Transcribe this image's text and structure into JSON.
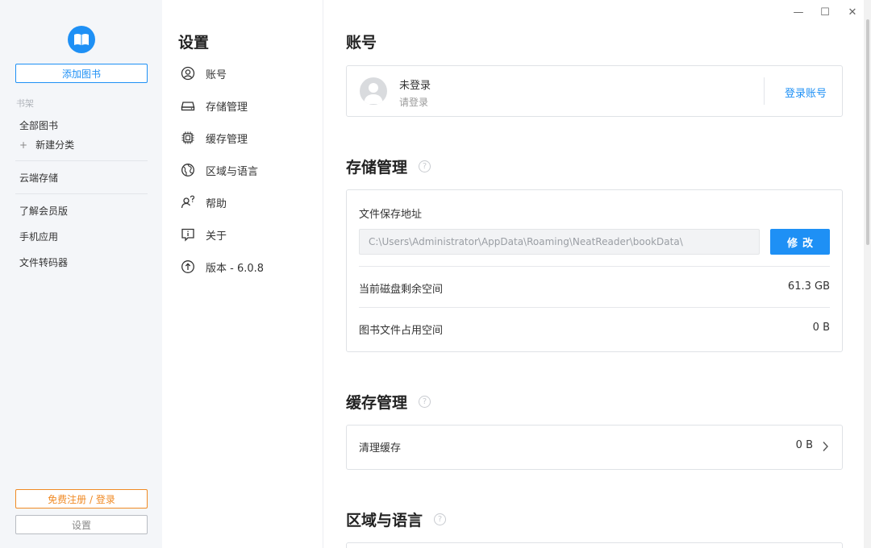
{
  "sidebar": {
    "add_book": "添加图书",
    "shelf_title": "书架",
    "all_books": "全部图书",
    "new_category_plus": "+",
    "new_category": "新建分类",
    "cloud_storage": "云端存储",
    "membership": "了解会员版",
    "mobile_app": "手机应用",
    "file_converter": "文件转码器",
    "register_login": "免费注册 / 登录",
    "settings": "设置"
  },
  "settings_nav": {
    "title": "设置",
    "items": [
      {
        "label": "账号",
        "icon": "account-icon"
      },
      {
        "label": "存储管理",
        "icon": "storage-icon"
      },
      {
        "label": "缓存管理",
        "icon": "chip-icon"
      },
      {
        "label": "区域与语言",
        "icon": "globe-icon"
      },
      {
        "label": "帮助",
        "icon": "help-user-icon"
      },
      {
        "label": "关于",
        "icon": "info-icon"
      },
      {
        "label": "版本 - 6.0.8",
        "icon": "upgrade-icon"
      }
    ]
  },
  "account": {
    "title": "账号",
    "name": "未登录",
    "sub": "请登录",
    "login_link": "登录账号"
  },
  "storage": {
    "title": "存储管理",
    "help": "?",
    "save_path_label": "文件保存地址",
    "save_path_value": "C:\\Users\\Administrator\\AppData\\Roaming\\NeatReader\\bookData\\",
    "modify_button": "修改",
    "disk_free_label": "当前磁盘剩余空间",
    "disk_free_value": "61.3 GB",
    "books_used_label": "图书文件占用空间",
    "books_used_value": "0 B"
  },
  "cache": {
    "title": "缓存管理",
    "help": "?",
    "clear_label": "清理缓存",
    "clear_value": "0 B"
  },
  "region": {
    "title": "区域与语言",
    "help": "?"
  },
  "window": {
    "minimize": "—",
    "maximize": "☐",
    "close": "✕"
  },
  "colors": {
    "accent": "#1e90f5",
    "register": "#f08a24",
    "sidebar_bg": "#f4f6f9"
  }
}
